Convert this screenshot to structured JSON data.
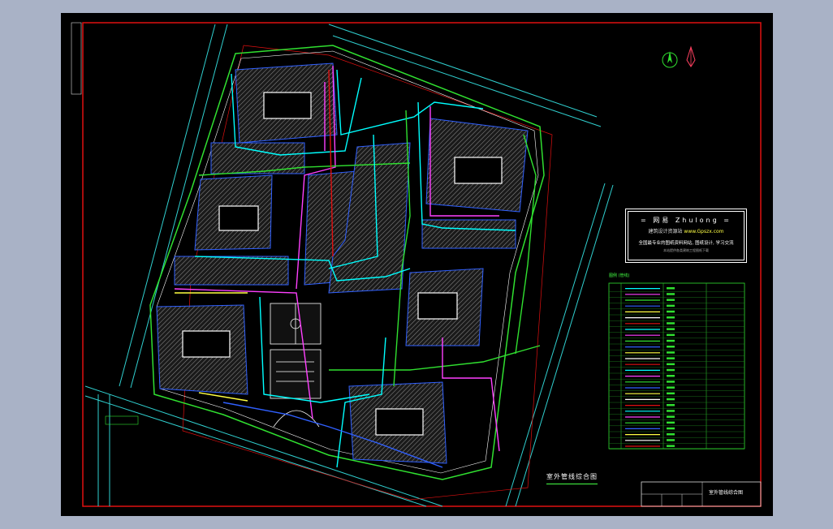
{
  "window": {
    "background": "#a9b2c6"
  },
  "colors": {
    "canvas": "#000000",
    "frame": "#e01010",
    "road": "#30d0d0",
    "green": "#30e030",
    "cyan": "#00ffff",
    "blue": "#3060ff",
    "magenta": "#ff40ff",
    "yellow": "#ffff40",
    "white": "#ffffff",
    "hatch": "#a0a0a0"
  },
  "logo_panel": {
    "brand": "= 网易 Zhulong =",
    "tagline": "建筑设计资源站",
    "url": "www.Gpszx.com",
    "slogan": "全国最专业的图纸资料网站, 图纸设计, 学习交流",
    "footnote": "本站提供各类建筑工程图纸下载"
  },
  "legend_title": "图例 (管线)",
  "legend_rows": 28,
  "drawing_caption": "室外管线综合图",
  "titleblock": {
    "name": "室外管线综合图"
  },
  "icons": [
    "north-arrow-icon",
    "compass-rose-icon"
  ]
}
